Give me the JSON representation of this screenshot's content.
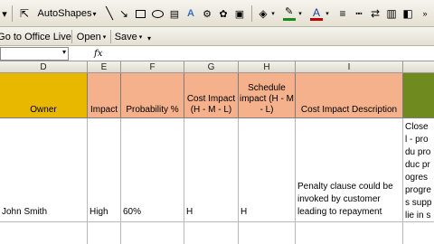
{
  "toolbar_draw": {
    "autoshapes_label": "AutoShapes",
    "colors": {
      "line": "#1a8a1a",
      "font": "#c00000",
      "fill": "#e6e6e6"
    }
  },
  "toolbar_web": {
    "go_to_office_live": "Go to Office Live",
    "open": "Open",
    "save": "Save"
  },
  "formula_bar": {
    "fx": "fx",
    "name_box": "",
    "value": ""
  },
  "columns": [
    {
      "letter": "D",
      "header": "Owner",
      "color": "#e8b800"
    },
    {
      "letter": "E",
      "header": "Impact",
      "color": "#f4b18c"
    },
    {
      "letter": "F",
      "header": "Probability %",
      "color": "#f4b18c"
    },
    {
      "letter": "G",
      "header": "Cost Impact (H - M - L)",
      "color": "#f4b18c"
    },
    {
      "letter": "H",
      "header": "Schedule impact (H - M - L)",
      "color": "#f4b18c"
    },
    {
      "letter": "I",
      "header": "Cost Impact Description",
      "color": "#f4b18c"
    },
    {
      "letter": "",
      "header": "",
      "color": "#6f8a1e"
    }
  ],
  "row": {
    "owner": "John Smith",
    "impact": "High",
    "probability": "60%",
    "cost_impact": "H",
    "schedule_impact": "H",
    "cost_desc": "Penalty clause could be invoked by customer leading to repayment",
    "next_col": "Close l - produ produc progres progres supplie in sche any de"
  }
}
